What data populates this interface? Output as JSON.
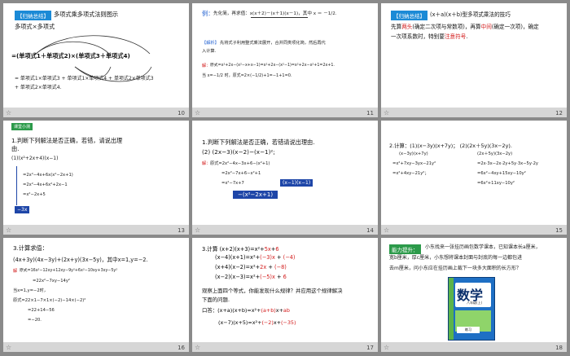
{
  "slides": [
    {
      "num": "10",
      "tag": "【归纳总结】",
      "title": "多项式乘多项式法则图示",
      "sub": "多项式×多项式",
      "formula": "=(单项式1＋单项式2)×(单项式3＋单项式4)",
      "line1": "= 单项式1×单项式3 + 单项式1×单项式4 + 单项式2×单项式3",
      "line2": "+ 单项式2×单项式4."
    },
    {
      "num": "11",
      "label": "例：",
      "problem": "先化简，再求值：x(x＋2)－(x＋1)(x－1)，其中 x ＝ －1/2.",
      "analysis_tag": "【解析】",
      "analysis": "先将式子利用整式乘法展开，合并同类项化简，然后再代",
      "analysis2": "入计算.",
      "sol_tag": "解：",
      "sol1": "原式=x²+2x−(x²−x+x−1)=x²+2x−(x²−1)=x²+2x−x²+1=2x+1.",
      "sol2": "当 x=−1/2 时，原式=2×(−1/2)+1=−1+1=0."
    },
    {
      "num": "12",
      "tag": "【归纳总结】",
      "title": "(x＋a)(x＋b)型多项式乘法的技巧",
      "l1a": "先算",
      "l1b": "两头",
      "l1c": "(确定二次项与常数项)，再算",
      "l1d": "中间",
      "l1e": "(确定一次项)，确定",
      "l2a": "一次项系数时，特别要",
      "l2b": "注意符号",
      "l2c": "."
    },
    {
      "num": "13",
      "tag": "课堂小测",
      "q1": "1.判断下列解法是否正确，若错，请说出理",
      "q2": "由.",
      "q3": "(1)(x²+2x+4)(x−1)",
      "w1": "=2x²−4x+6x(x²−2x+1)",
      "w2": "=2x²−4x+6x²+2x−1",
      "w3": "=x²−2x+5",
      "box": "−3x"
    },
    {
      "num": "14",
      "q1": "1.判断下列解法是否正确，若错请说出理由.",
      "q2": "(2)  (2x−3)(x−2)−(x−1)²;",
      "sol_tag": "解：",
      "s1": "原式=2x²−4x−3x+6−(x²+1)",
      "s2": "=2x²−7x+6−x²+1",
      "s3": "=x²−7x+7",
      "box1": "(x−1)(x−1)",
      "box2": "−(x²−2x+1)"
    },
    {
      "num": "15",
      "title": "2.计算：(1)(x−3y)(x+7y)；        (2)(2x＋5y)(3x−2y).",
      "a1": "(x−3y)(x+7y)",
      "a2": "=x²+7xy−3yx−21y²",
      "a3": "=x²+4xy−21y²；",
      "b1": "(2x＋5y)(3x−2y)",
      "b2": "=2x·3x−2x·2y+5y·3x−5y·2y",
      "b3": "=6x²−4xy+15xy−10y²",
      "b4": "=6x²+11xy−10y²"
    },
    {
      "num": "16",
      "title": "3.计算求值：",
      "q": "(4x+3y)(4x−3y)+(2x+y)(3x−5y)，其中x=1,y=−2.",
      "sol_tag": "解",
      "s1": "原式=16x²−12xy+12xy−9y²+6x²−10xy+3xy−5y²",
      "s2": "=22x²−7xy−14y²",
      "s3": "当x=1,y=−2时，",
      "s4": "原式=22×1−7×1×(−2)−14×(−2)²",
      "s5": "=22+14−56",
      "s6": "=−20."
    },
    {
      "num": "17",
      "q1": "3.计算  (x+2)(x+3)=x²+",
      "q1r": "5x",
      "q1e": "+",
      "q1r2": "6",
      "q2": "(x−4)(x+1)=x²+",
      "q2r": "(−3)x",
      "q2r2": "(−4)",
      "q3": "(x+4)(x−2)=x²+",
      "q3r": "2x",
      "q3r2": "(−8)",
      "q4": "(x−2)(x−3)=x²+",
      "q4r": "(−5)x",
      "q4r2": "6",
      "obs1": "观察上面四个等式，你能发现什么规律？并应用这个规律解决",
      "obs2": "下面的问题.",
      "fill": "口答：(x+a)(x+b)=x²+",
      "fillr": "(a+b)",
      "fillx": "x+",
      "fillr2": "ab",
      "f2": "(x−7)(x+5)=x²+",
      "f2r": "(−2)",
      "f2x": "x+",
      "f2r2": "(−35)"
    },
    {
      "num": "18",
      "tag": "能力提升：",
      "p1": "小东找来一张挂历画包数学课本，已知课本长a厘米，",
      "p2": "宽b厘米，厚c厘米，小东想将课本封面与封底的每一边都包进",
      "p3": "去m厘米，问小东应在挂历画上裁下一块多大面积的长方形？",
      "book_title": "数学",
      "book_sub": "八年级(上)",
      "book_cap": "练习"
    }
  ]
}
